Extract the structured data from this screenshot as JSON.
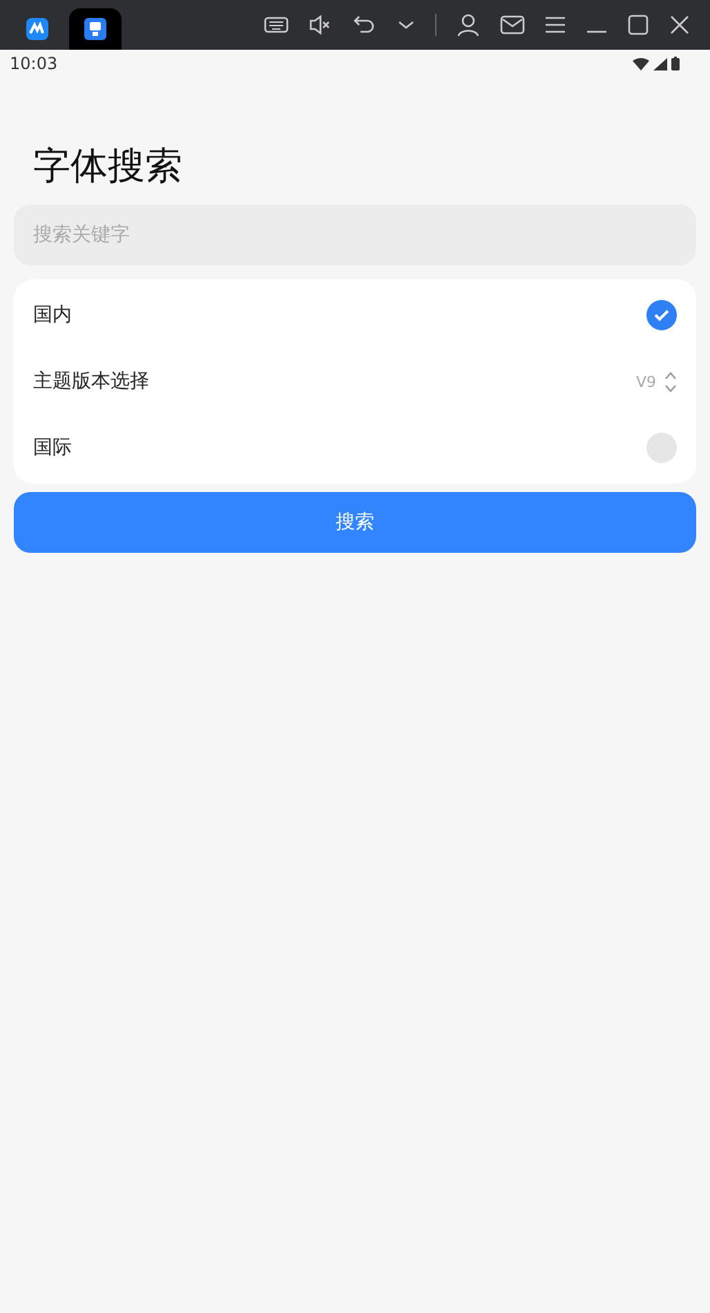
{
  "emulator_tabs": [
    {
      "selected": false
    },
    {
      "selected": true
    }
  ],
  "status_bar": {
    "time": "10:03"
  },
  "title": "字体搜索",
  "search": {
    "placeholder": "搜索关键字"
  },
  "options": [
    {
      "kind": "radio",
      "label": "国内",
      "selected": true
    },
    {
      "kind": "select",
      "label": "主题版本选择",
      "value": "V9"
    },
    {
      "kind": "radio",
      "label": "国际",
      "selected": false
    }
  ],
  "button": "搜索"
}
